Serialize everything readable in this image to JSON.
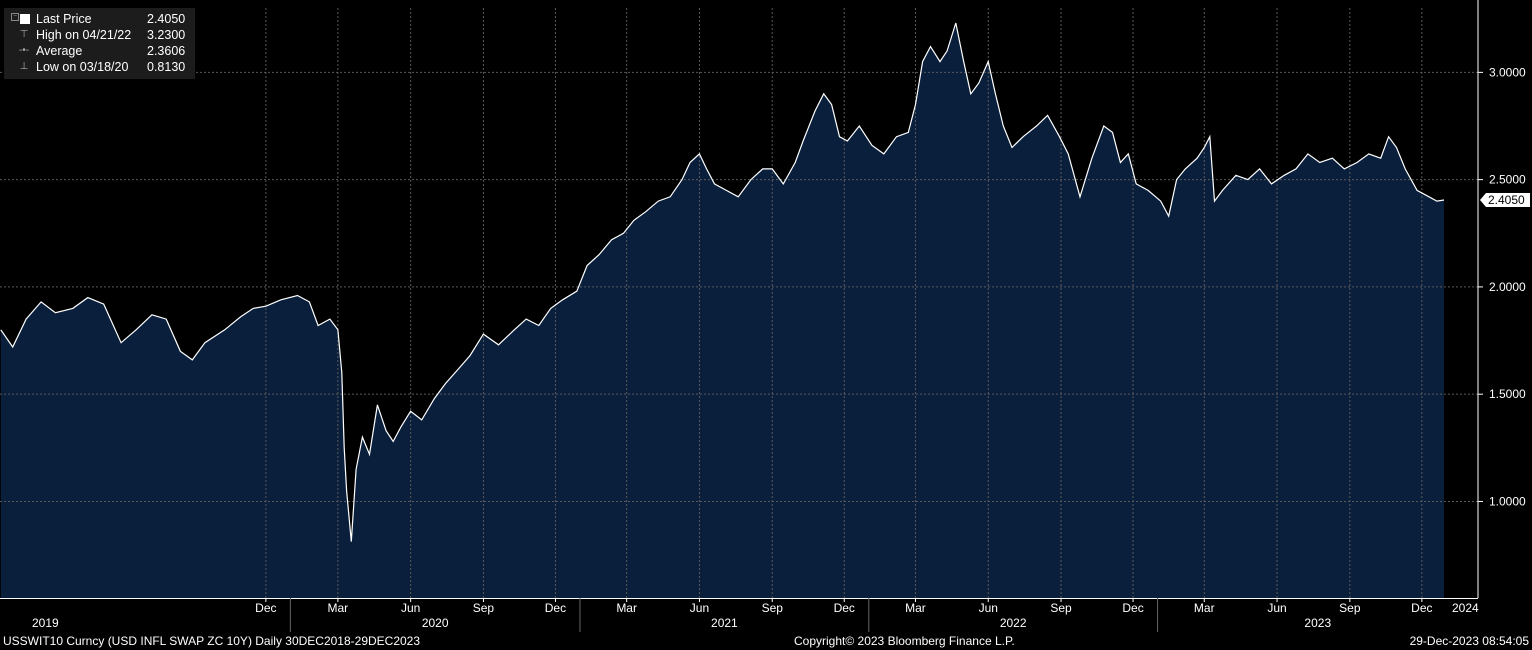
{
  "legend": {
    "last_label": "Last Price",
    "last_value": "2.4050",
    "high_label": "High on 04/21/22",
    "high_value": "3.2300",
    "avg_label": "Average",
    "avg_value": "2.3606",
    "low_label": "Low on 03/18/20",
    "low_value": "0.8130"
  },
  "footer": {
    "security": "USSWIT10 Curncy (USD INFL SWAP ZC 10Y)  Daily 30DEC2018-29DEC2023",
    "copyright": "Copyright© 2023 Bloomberg Finance L.P.",
    "timestamp": "29-Dec-2023 08:54:05"
  },
  "colors": {
    "background": "#000000",
    "area_fill": "#0a1f3c",
    "line": "#ffffff",
    "legend_bg": "#1c1c1c",
    "grid": "#5a5a5a"
  },
  "chart_data": {
    "type": "area",
    "title": "",
    "ylim": [
      0.55,
      3.3
    ],
    "yticks": [
      {
        "value": 1.0,
        "label": "1.0000"
      },
      {
        "value": 1.5,
        "label": "1.5000"
      },
      {
        "value": 2.0,
        "label": "2.0000"
      },
      {
        "value": 2.5,
        "label": "2.5000"
      },
      {
        "value": 3.0,
        "label": "3.0000"
      }
    ],
    "last_value_label": "2.4050",
    "xlim": [
      "2018-12-30",
      "2023-12-29"
    ],
    "x_month_ticks": [
      {
        "date": "2019-12-01",
        "label": "Dec"
      },
      {
        "date": "2020-03-01",
        "label": "Mar"
      },
      {
        "date": "2020-06-01",
        "label": "Jun"
      },
      {
        "date": "2020-09-01",
        "label": "Sep"
      },
      {
        "date": "2020-12-01",
        "label": "Dec"
      },
      {
        "date": "2021-03-01",
        "label": "Mar"
      },
      {
        "date": "2021-06-01",
        "label": "Jun"
      },
      {
        "date": "2021-09-01",
        "label": "Sep"
      },
      {
        "date": "2021-12-01",
        "label": "Dec"
      },
      {
        "date": "2022-03-01",
        "label": "Mar"
      },
      {
        "date": "2022-06-01",
        "label": "Jun"
      },
      {
        "date": "2022-09-01",
        "label": "Sep"
      },
      {
        "date": "2022-12-01",
        "label": "Dec"
      },
      {
        "date": "2023-03-01",
        "label": "Mar"
      },
      {
        "date": "2023-06-01",
        "label": "Jun"
      },
      {
        "date": "2023-09-01",
        "label": "Sep"
      },
      {
        "date": "2023-12-01",
        "label": "Dec"
      }
    ],
    "x_year_labels": [
      {
        "date": "2019-01-01",
        "label": "2019"
      },
      {
        "date": "2020-01-01",
        "label": "2020"
      },
      {
        "date": "2021-01-01",
        "label": "2021"
      },
      {
        "date": "2022-01-01",
        "label": "2022"
      },
      {
        "date": "2023-01-01",
        "label": "2023"
      },
      {
        "date": "2024-01-01",
        "label": "2024"
      }
    ],
    "series": [
      {
        "name": "Last Price",
        "points": [
          [
            "2018-12-31",
            1.8
          ],
          [
            "2019-01-15",
            1.72
          ],
          [
            "2019-02-01",
            1.85
          ],
          [
            "2019-02-20",
            1.93
          ],
          [
            "2019-03-10",
            1.88
          ],
          [
            "2019-04-01",
            1.9
          ],
          [
            "2019-04-20",
            1.95
          ],
          [
            "2019-05-10",
            1.92
          ],
          [
            "2019-06-01",
            1.74
          ],
          [
            "2019-06-20",
            1.8
          ],
          [
            "2019-07-10",
            1.87
          ],
          [
            "2019-07-28",
            1.85
          ],
          [
            "2019-08-15",
            1.7
          ],
          [
            "2019-08-30",
            1.66
          ],
          [
            "2019-09-15",
            1.74
          ],
          [
            "2019-10-10",
            1.8
          ],
          [
            "2019-10-30",
            1.86
          ],
          [
            "2019-11-15",
            1.9
          ],
          [
            "2019-12-01",
            1.91
          ],
          [
            "2019-12-20",
            1.94
          ],
          [
            "2020-01-10",
            1.96
          ],
          [
            "2020-01-25",
            1.93
          ],
          [
            "2020-02-05",
            1.82
          ],
          [
            "2020-02-20",
            1.85
          ],
          [
            "2020-03-01",
            1.8
          ],
          [
            "2020-03-06",
            1.6
          ],
          [
            "2020-03-09",
            1.25
          ],
          [
            "2020-03-12",
            1.05
          ],
          [
            "2020-03-18",
            0.813
          ],
          [
            "2020-03-24",
            1.15
          ],
          [
            "2020-04-01",
            1.3
          ],
          [
            "2020-04-10",
            1.22
          ],
          [
            "2020-04-20",
            1.45
          ],
          [
            "2020-05-01",
            1.33
          ],
          [
            "2020-05-10",
            1.28
          ],
          [
            "2020-05-20",
            1.35
          ],
          [
            "2020-06-01",
            1.42
          ],
          [
            "2020-06-15",
            1.38
          ],
          [
            "2020-07-01",
            1.48
          ],
          [
            "2020-07-15",
            1.55
          ],
          [
            "2020-08-01",
            1.62
          ],
          [
            "2020-08-15",
            1.68
          ],
          [
            "2020-09-01",
            1.78
          ],
          [
            "2020-09-20",
            1.73
          ],
          [
            "2020-10-10",
            1.8
          ],
          [
            "2020-10-25",
            1.85
          ],
          [
            "2020-11-10",
            1.82
          ],
          [
            "2020-11-25",
            1.9
          ],
          [
            "2020-12-10",
            1.94
          ],
          [
            "2020-12-28",
            1.98
          ],
          [
            "2021-01-10",
            2.1
          ],
          [
            "2021-01-25",
            2.15
          ],
          [
            "2021-02-10",
            2.22
          ],
          [
            "2021-02-25",
            2.25
          ],
          [
            "2021-03-10",
            2.31
          ],
          [
            "2021-03-25",
            2.35
          ],
          [
            "2021-04-10",
            2.4
          ],
          [
            "2021-04-25",
            2.42
          ],
          [
            "2021-05-10",
            2.5
          ],
          [
            "2021-05-20",
            2.58
          ],
          [
            "2021-06-01",
            2.62
          ],
          [
            "2021-06-10",
            2.55
          ],
          [
            "2021-06-20",
            2.48
          ],
          [
            "2021-07-05",
            2.45
          ],
          [
            "2021-07-20",
            2.42
          ],
          [
            "2021-08-05",
            2.5
          ],
          [
            "2021-08-20",
            2.55
          ],
          [
            "2021-09-01",
            2.55
          ],
          [
            "2021-09-15",
            2.48
          ],
          [
            "2021-09-30",
            2.58
          ],
          [
            "2021-10-10",
            2.68
          ],
          [
            "2021-10-25",
            2.82
          ],
          [
            "2021-11-05",
            2.9
          ],
          [
            "2021-11-15",
            2.85
          ],
          [
            "2021-11-25",
            2.7
          ],
          [
            "2021-12-05",
            2.68
          ],
          [
            "2021-12-20",
            2.75
          ],
          [
            "2022-01-05",
            2.66
          ],
          [
            "2022-01-20",
            2.62
          ],
          [
            "2022-02-05",
            2.7
          ],
          [
            "2022-02-20",
            2.72
          ],
          [
            "2022-03-01",
            2.85
          ],
          [
            "2022-03-10",
            3.05
          ],
          [
            "2022-03-20",
            3.12
          ],
          [
            "2022-04-01",
            3.05
          ],
          [
            "2022-04-10",
            3.1
          ],
          [
            "2022-04-21",
            3.23
          ],
          [
            "2022-05-01",
            3.05
          ],
          [
            "2022-05-10",
            2.9
          ],
          [
            "2022-05-20",
            2.95
          ],
          [
            "2022-06-01",
            3.05
          ],
          [
            "2022-06-10",
            2.9
          ],
          [
            "2022-06-20",
            2.75
          ],
          [
            "2022-07-01",
            2.65
          ],
          [
            "2022-07-15",
            2.7
          ],
          [
            "2022-08-01",
            2.75
          ],
          [
            "2022-08-15",
            2.8
          ],
          [
            "2022-08-30",
            2.7
          ],
          [
            "2022-09-10",
            2.62
          ],
          [
            "2022-09-25",
            2.42
          ],
          [
            "2022-10-10",
            2.6
          ],
          [
            "2022-10-25",
            2.75
          ],
          [
            "2022-11-05",
            2.72
          ],
          [
            "2022-11-15",
            2.58
          ],
          [
            "2022-11-25",
            2.62
          ],
          [
            "2022-12-05",
            2.48
          ],
          [
            "2022-12-20",
            2.45
          ],
          [
            "2023-01-05",
            2.4
          ],
          [
            "2023-01-15",
            2.33
          ],
          [
            "2023-01-25",
            2.5
          ],
          [
            "2023-02-05",
            2.55
          ],
          [
            "2023-02-20",
            2.6
          ],
          [
            "2023-03-01",
            2.65
          ],
          [
            "2023-03-08",
            2.7
          ],
          [
            "2023-03-14",
            2.4
          ],
          [
            "2023-03-24",
            2.45
          ],
          [
            "2023-04-10",
            2.52
          ],
          [
            "2023-04-25",
            2.5
          ],
          [
            "2023-05-10",
            2.55
          ],
          [
            "2023-05-25",
            2.48
          ],
          [
            "2023-06-10",
            2.52
          ],
          [
            "2023-06-25",
            2.55
          ],
          [
            "2023-07-10",
            2.62
          ],
          [
            "2023-07-25",
            2.58
          ],
          [
            "2023-08-10",
            2.6
          ],
          [
            "2023-08-25",
            2.55
          ],
          [
            "2023-09-10",
            2.58
          ],
          [
            "2023-09-25",
            2.62
          ],
          [
            "2023-10-10",
            2.6
          ],
          [
            "2023-10-20",
            2.7
          ],
          [
            "2023-10-30",
            2.65
          ],
          [
            "2023-11-10",
            2.55
          ],
          [
            "2023-11-25",
            2.45
          ],
          [
            "2023-12-10",
            2.42
          ],
          [
            "2023-12-20",
            2.4
          ],
          [
            "2023-12-29",
            2.405
          ]
        ]
      }
    ]
  }
}
